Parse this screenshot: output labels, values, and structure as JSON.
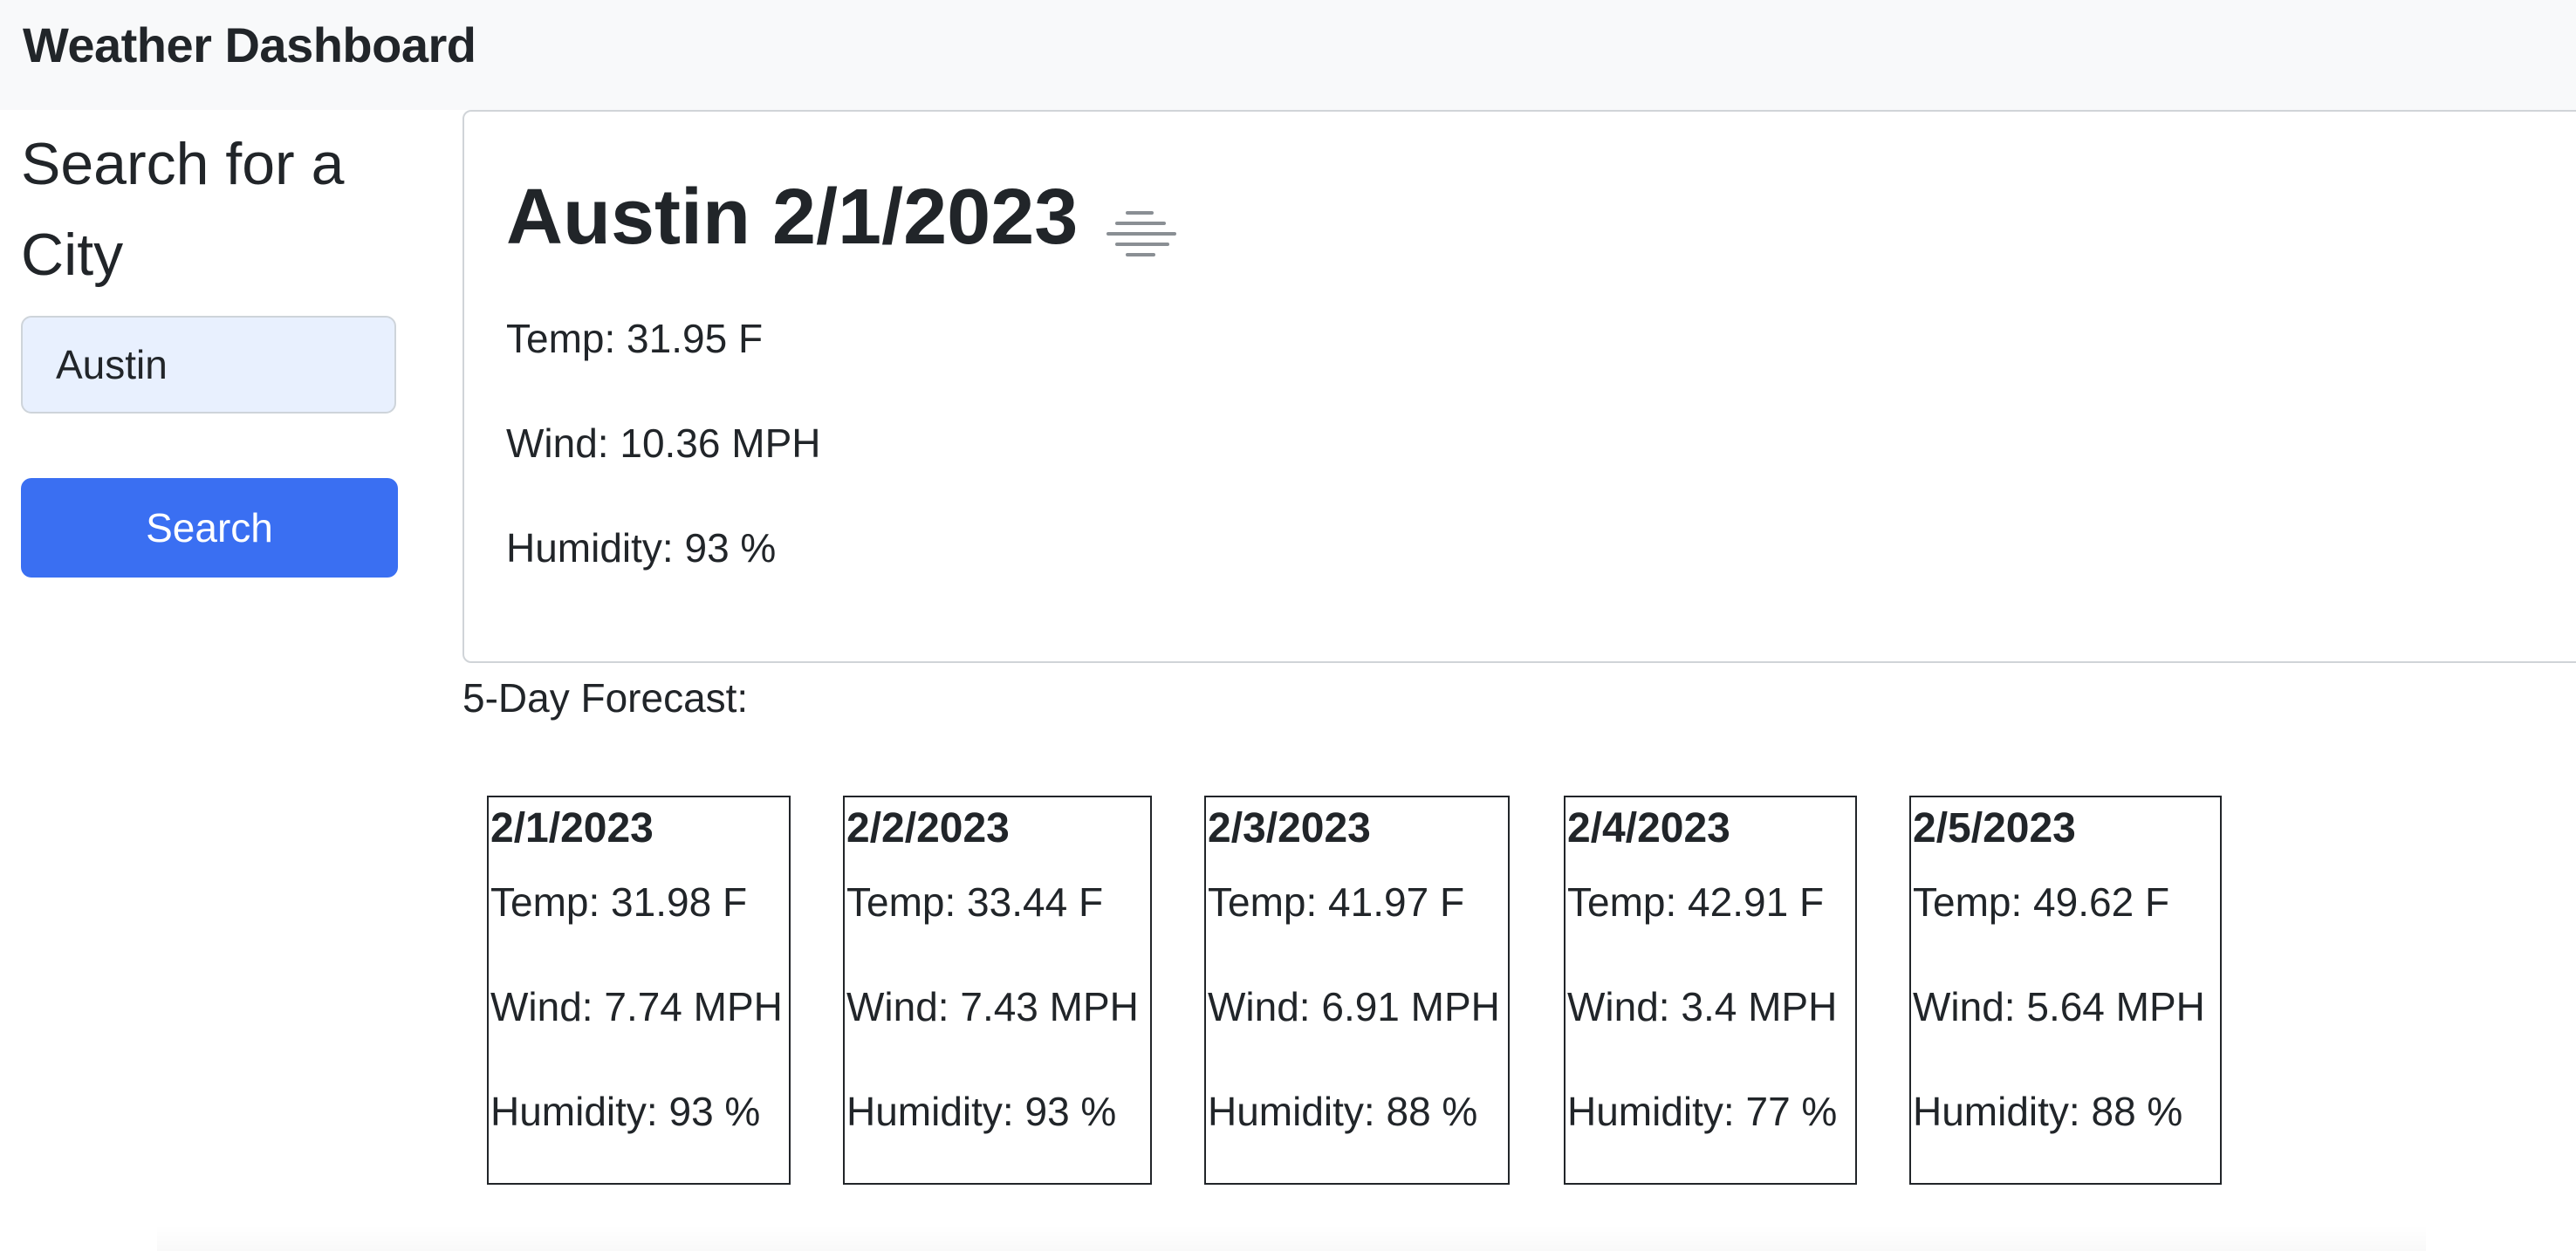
{
  "header": {
    "brand": "Weather Dashboard"
  },
  "sidebar": {
    "heading": "Search for a City",
    "search_input_value": "Austin",
    "search_button_label": "Search"
  },
  "current": {
    "title": "Austin 2/1/2023",
    "icon": "mist-icon",
    "temp": "Temp: 31.95 F",
    "wind": "Wind: 10.36 MPH",
    "humidity": "Humidity: 93 %"
  },
  "forecast": {
    "heading": "5-Day Forecast:",
    "days": [
      {
        "date": "2/1/2023",
        "temp": "Temp: 31.98 F",
        "wind": "Wind: 7.74 MPH",
        "humidity": "Humidity: 93 %"
      },
      {
        "date": "2/2/2023",
        "temp": "Temp: 33.44 F",
        "wind": "Wind: 7.43 MPH",
        "humidity": "Humidity: 93 %"
      },
      {
        "date": "2/3/2023",
        "temp": "Temp: 41.97 F",
        "wind": "Wind: 6.91 MPH",
        "humidity": "Humidity: 88 %"
      },
      {
        "date": "2/4/2023",
        "temp": "Temp: 42.91 F",
        "wind": "Wind: 3.4 MPH",
        "humidity": "Humidity: 77 %"
      },
      {
        "date": "2/5/2023",
        "temp": "Temp: 49.62 F",
        "wind": "Wind: 5.64 MPH",
        "humidity": "Humidity: 88 %"
      }
    ]
  },
  "colors": {
    "primary": "#3a6ff2",
    "navbar_bg": "#f8f9fa",
    "input_bg": "#e8f0fe",
    "text": "#212529"
  }
}
